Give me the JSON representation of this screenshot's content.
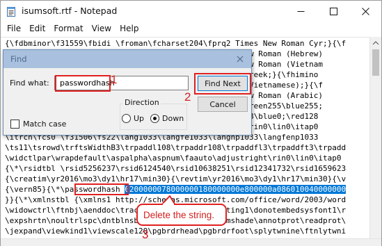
{
  "window": {
    "title": "isumsoft.rtf - Notepad",
    "icons": {
      "app": "notepad-icon",
      "minimize": "minimize-icon",
      "maximize": "maximize-icon",
      "close": "close-icon"
    }
  },
  "menu": [
    "File",
    "Edit",
    "Format",
    "View",
    "Help"
  ],
  "editor_lines": [
    "{\\fdbminor\\f31559\\fbidi \\froman\\fcharset204\\fprq2 Times New Roman Cyr;}{\\f",
    "                                             Times New Roman (Hebrew)",
    "                                             Times New Roman (Vietnam",
    "                                             alibri Greek;}{\\fhimino",
    "                                             alibri (Vietnamese);}{\\f",
    "                                             Times New Roman (Arabic)",
    "                                              \\red0\\green255\\blue255;",
    "                                              green128\\blue0;\\red128",
    "                                              tright\\rin0\\lin0\\itap0",
    "\\itrch\\fcs0 \\f31506\\fs22\\lang1033\\langfe1033\\langnp1033\\langfenp1033",
    "\\ts11\\tsrowd\\trftsWidthB3\\trpaddl108\\trpaddr108\\trpaddfl3\\trpaddft3\\trpadd",
    "\\widctlpar\\wrapdefault\\aspalpha\\aspnum\\faauto\\adjustright\\rin0\\lin0\\itap0",
    "{\\*\\rsidtbl \\rsid5256237\\rsid6124540\\rsid10638251\\rsid12341732\\rsid1659623",
    "{\\creatim\\yr2016\\mo3\\dy1\\hr17\\min30}{\\revtim\\yr2016\\mo3\\dy1\\hr17\\min30}{\\v",
    "{\\vern85}{\\*\\",
    "}}{\\*\\xmlnstbl {\\xmlns1 http://schemas.microsoft.com/office/word/2003/word",
    "\\widowctrl\\ftnbj\\aenddoc\\trackmoves0\\trackformatting1\\donotembedsysfont1\\r",
    "\\expshrtn\\noultrlspc\\dntblnsbdb\\nospaceforul\\formshade\\annotprot\\readprot\\",
    "\\jexpand\\viewkind1\\viewscale120\\pgbrdrhead\\pgbrdrfoot\\splytwnine\\ftnlytwni"
  ],
  "selected_line": {
    "prefix": "{\\vern85}{\\*\\",
    "keyword": "passwordhash",
    "value": "0200000078000000180000000e800000a086010040000000"
  },
  "find_dialog": {
    "title": "Find",
    "find_what_label": "Find what:",
    "find_what_value": "passwordhash",
    "find_next_label": "Find Next",
    "cancel_label": "Cancel",
    "direction_label": "Direction",
    "up_label": "Up",
    "down_label": "Down",
    "direction_selected": "Down",
    "match_case_label": "Match case",
    "match_case_checked": false,
    "close_icon": "close-icon"
  },
  "annotations": {
    "step1": "1",
    "step2": "2",
    "step3": "3",
    "callout": "Delete the string.",
    "color": "#e02020"
  }
}
